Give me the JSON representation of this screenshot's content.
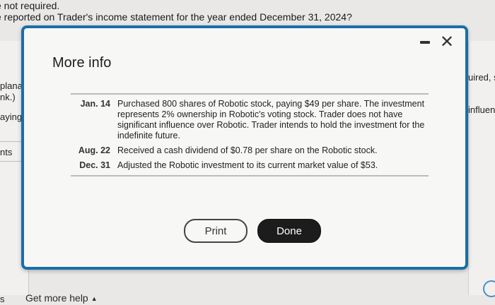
{
  "background": {
    "line1": "e not required.",
    "line2": "e reported on Trader's income statement for the year ended December 31, 2024?",
    "left_fragments": [
      "planat",
      "nk.)",
      "aying $",
      "nts",
      "s"
    ],
    "right_fragments": [
      "uired, s",
      "influen"
    ],
    "help_label": "Get more help",
    "help_caret": "▲"
  },
  "modal": {
    "title": "More info",
    "minimize_glyph": "—",
    "close_glyph": "✕",
    "entries": [
      {
        "date": "Jan. 14",
        "text": "Purchased 800 shares of Robotic stock, paying $49 per share. The investment represents 2% ownership in Robotic's voting stock. Trader does not have significant influence over Robotic. Trader intends to hold the investment for the indefinite future."
      },
      {
        "date": "Aug. 22",
        "text": "Received a cash dividend of $0.78 per share on the Robotic stock."
      },
      {
        "date": "Dec. 31",
        "text": "Adjusted the Robotic investment to its current market value of $53."
      }
    ],
    "print_label": "Print",
    "done_label": "Done"
  },
  "colors": {
    "modal_border": "#1a6ea8",
    "done_bg": "#1c1c1c"
  }
}
